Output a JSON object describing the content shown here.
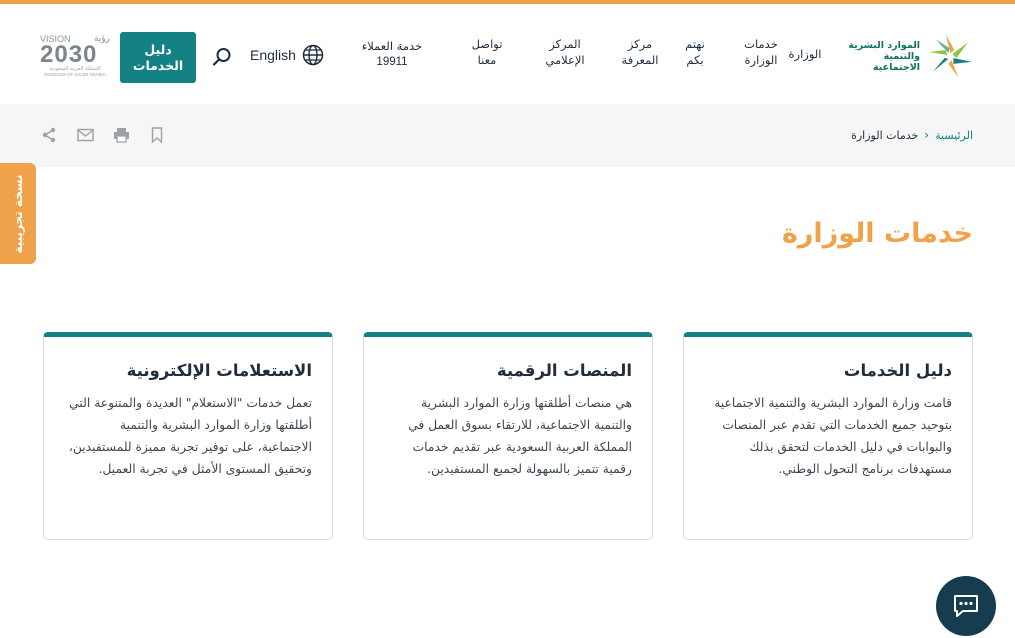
{
  "header": {
    "logo_text_line1": "الموارد البشرية",
    "logo_text_line2": "والتنمية الاجتماعية",
    "nav": [
      {
        "line1": "الوزارة",
        "line2": ""
      },
      {
        "line1": "خدمات",
        "line2": "الوزارة"
      },
      {
        "line1": "نهتم",
        "line2": "بكم"
      },
      {
        "line1": "مركز",
        "line2": "المعرفة"
      },
      {
        "line1": "المركز",
        "line2": "الإعلامي"
      },
      {
        "line1": "تواصل",
        "line2": "معنا"
      }
    ],
    "customer_service_label": "خدمة العملاء",
    "customer_service_number": "19911",
    "language_label": "English",
    "guide_button_line1": "دليل",
    "guide_button_line2": "الخدمات",
    "vision_title": "VISION",
    "vision_arabic": "رؤية",
    "vision_year": "2030",
    "vision_sub_ar": "المملكة العربية السعودية",
    "vision_sub_en": "KINGDOM OF SAUDI ARABIA"
  },
  "breadcrumb": {
    "home": "الرئيسية",
    "current": "خدمات الوزارة"
  },
  "side_tab": {
    "label": "نسخة تجريبية"
  },
  "page": {
    "title": "خدمات الوزارة"
  },
  "cards": [
    {
      "title": "دليل الخدمات",
      "body": "قامت وزارة الموارد البشرية والتنمية الاجتماعية بتوحيد جميع الخدمات التي تقدم عبر المنصات والبوابات في دليل الخدمات لتحقق بذلك مستهدفات برنامج التحول الوطني."
    },
    {
      "title": "المنصات الرقمية",
      "body": "هي منصات أطلقتها وزارة الموارد البشرية والتنمية الاجتماعية، للارتقاء بسوق العمل في المملكة العربية السعودية عبر تقديم خدمات رقمية تتميز بالسهولة لجميع المستفيدين."
    },
    {
      "title": "الاستعلامات الإلكترونية",
      "body": "تعمل خدمات \"الاستعلام\" العديدة والمتنوعة التي أطلقتها وزارة الموارد البشرية والتنمية الاجتماعية، على توفير تجربة مميزة للمستفيدين، وتحقيق المستوى الأمثل في تجربة العميل."
    }
  ],
  "icons": {
    "bookmark": "bookmark-icon",
    "print": "print-icon",
    "mail": "mail-icon",
    "share": "share-icon",
    "search": "search-icon",
    "globe": "globe-icon",
    "chat": "chat-icon"
  },
  "colors": {
    "accent_orange": "#f0a24a",
    "teal": "#148185",
    "dark_navy": "#163c4f"
  }
}
